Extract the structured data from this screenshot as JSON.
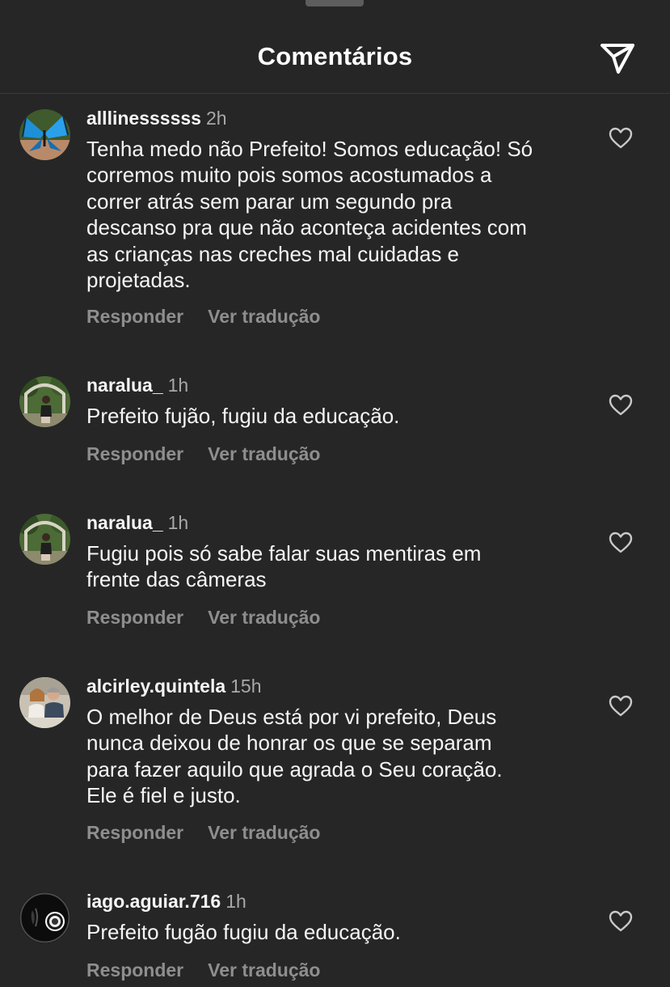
{
  "header": {
    "title": "Comentários",
    "share_icon": "paper-plane-icon"
  },
  "actions": {
    "reply": "Responder",
    "translate": "Ver tradução"
  },
  "comments": [
    {
      "username": "alllinessssss",
      "time": "2h",
      "text": "Tenha medo não Prefeito! Somos educação! Só\ncorremos muito pois somos acostumados a\ncorrer atrás sem parar um segundo pra\ndescanso pra que não aconteça acidentes com\nas crianças nas creches mal cuidadas e\nprojetadas.",
      "avatar": "butterfly-avatar"
    },
    {
      "username": "naralua_",
      "time": "1h",
      "text": "Prefeito fujão, fugiu da educação.",
      "avatar": "garden-photo-avatar"
    },
    {
      "username": "naralua_",
      "time": "1h",
      "text": "Fugiu pois só sabe falar suas mentiras em\nfrente das câmeras",
      "avatar": "garden-photo-avatar"
    },
    {
      "username": "alcirley.quintela",
      "time": "15h",
      "text": "O melhor de Deus está por vi prefeito, Deus\nnunca deixou de honrar os que se separam\npara fazer aquilo que agrada o Seu coração.\nEle é fiel e justo.",
      "avatar": "couple-photo-avatar"
    },
    {
      "username": "iago.aguiar.716",
      "time": "1h",
      "text": "Prefeito fugão fugiu da educação.",
      "avatar": "emblem-avatar"
    }
  ],
  "colors": {
    "background": "#262626",
    "text": "#f5f5f5",
    "secondary_text": "#a8a8a8",
    "action_text": "#8e8e8e"
  }
}
